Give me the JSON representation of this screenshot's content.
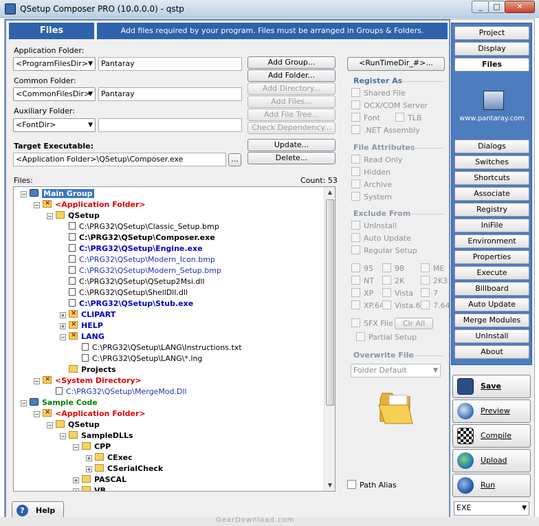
{
  "window": {
    "title": "QSetup Composer PRO (10.0.0.0) - qstp",
    "min": "_",
    "max": "□",
    "close": "✕"
  },
  "header": {
    "tab": "Files",
    "banner": "Add files required by your program.  Files must be arranged in Groups & Folders."
  },
  "folders": {
    "app_label": "Application Folder:",
    "app_combo": "<ProgramFilesDir>",
    "app_value": "Pantaray",
    "common_label": "Common Folder:",
    "common_combo": "<CommonFilesDir>",
    "common_value": "Pantaray",
    "aux_label": "Auxiliary Folder:",
    "aux_combo": "<FontDir>",
    "aux_value": ""
  },
  "buttons": {
    "add_group": "Add Group...",
    "add_folder": "Add Folder...",
    "add_directory": "Add Directory...",
    "add_files": "Add Files...",
    "add_file_tree": "Add File Tree...",
    "check_dependency": "Check Dependency...",
    "update": "Update...",
    "delete": "Delete...",
    "runtime_dir": "<RunTimeDir_#>...",
    "browse": "...",
    "clr_all": "Clr All",
    "help": "Help"
  },
  "target": {
    "label": "Target Executable:",
    "value": "<Application Folder>\\QSetup\\Composer.exe"
  },
  "files": {
    "label": "Files:",
    "count": "Count: 53"
  },
  "tree": [
    {
      "label": "Main Group",
      "style": "sel",
      "icon": "grpi",
      "indent": 0,
      "exp": "−"
    },
    {
      "label": "<Application Folder>",
      "style": "red",
      "icon": "foldx",
      "indent": 1,
      "exp": "−"
    },
    {
      "label": "QSetup",
      "style": "bold",
      "icon": "fold",
      "indent": 2,
      "exp": "−"
    },
    {
      "label": "C:\\PRG32\\QSetup\\Classic_Setup.bmp",
      "style": "",
      "icon": "doc",
      "indent": 3,
      "exp": ""
    },
    {
      "label": "C:\\PRG32\\QSetup\\Composer.exe",
      "style": "bold",
      "icon": "doc",
      "indent": 3,
      "exp": ""
    },
    {
      "label": "C:\\PRG32\\QSetup\\Engine.exe",
      "style": "blueb",
      "icon": "doc",
      "indent": 3,
      "exp": ""
    },
    {
      "label": "C:\\PRG32\\QSetup\\Modern_Icon.bmp",
      "style": "blue",
      "icon": "doc",
      "indent": 3,
      "exp": ""
    },
    {
      "label": "C:\\PRG32\\QSetup\\Modern_Setup.bmp",
      "style": "blue",
      "icon": "doc",
      "indent": 3,
      "exp": ""
    },
    {
      "label": "C:\\PRG32\\QSetup\\QSetup2Msi.dll",
      "style": "",
      "icon": "doc",
      "indent": 3,
      "exp": ""
    },
    {
      "label": "C:\\PRG32\\QSetup\\ShellDll.dll",
      "style": "",
      "icon": "doc",
      "indent": 3,
      "exp": ""
    },
    {
      "label": "C:\\PRG32\\QSetup\\Stub.exe",
      "style": "blueb",
      "icon": "doc",
      "indent": 3,
      "exp": ""
    },
    {
      "label": "CLIPART",
      "style": "blueb",
      "icon": "foldx",
      "indent": 3,
      "exp": "+"
    },
    {
      "label": "HELP",
      "style": "blueb",
      "icon": "foldx",
      "indent": 3,
      "exp": "+"
    },
    {
      "label": "LANG",
      "style": "blueb",
      "icon": "foldx",
      "indent": 3,
      "exp": "−"
    },
    {
      "label": "C:\\PRG32\\QSetup\\LANG\\Instructions.txt",
      "style": "",
      "icon": "doc",
      "indent": 4,
      "exp": ""
    },
    {
      "label": "C:\\PRG32\\QSetup\\LANG\\*.lng",
      "style": "",
      "icon": "doc",
      "indent": 4,
      "exp": ""
    },
    {
      "label": "Projects",
      "style": "bold",
      "icon": "fold",
      "indent": 3,
      "exp": ""
    },
    {
      "label": "<System Directory>",
      "style": "red",
      "icon": "foldx",
      "indent": 1,
      "exp": "−"
    },
    {
      "label": "C:\\PRG32\\QSetup\\MergeMod.Dll",
      "style": "blue",
      "icon": "doc",
      "indent": 2,
      "exp": ""
    },
    {
      "label": "Sample Code",
      "style": "green",
      "icon": "grpi",
      "indent": 0,
      "exp": "−"
    },
    {
      "label": "<Application Folder>",
      "style": "red",
      "icon": "foldx",
      "indent": 1,
      "exp": "−"
    },
    {
      "label": "QSetup",
      "style": "bold",
      "icon": "fold",
      "indent": 2,
      "exp": "−"
    },
    {
      "label": "SampleDLLs",
      "style": "bold",
      "icon": "fold",
      "indent": 3,
      "exp": "−"
    },
    {
      "label": "CPP",
      "style": "bold",
      "icon": "fold",
      "indent": 4,
      "exp": "−"
    },
    {
      "label": "CExec",
      "style": "bold",
      "icon": "fold",
      "indent": 5,
      "exp": "+"
    },
    {
      "label": "CSerialCheck",
      "style": "bold",
      "icon": "fold",
      "indent": 5,
      "exp": "+"
    },
    {
      "label": "PASCAL",
      "style": "bold",
      "icon": "fold",
      "indent": 4,
      "exp": "+"
    },
    {
      "label": "VB",
      "style": "bold",
      "icon": "fold",
      "indent": 4,
      "exp": "+"
    }
  ],
  "register": {
    "title": "Register As",
    "shared": "Shared File",
    "ocx": "OCX/COM Server",
    "font": "Font",
    "tlb": "TLB",
    "net": ".NET Assembly"
  },
  "attributes": {
    "title": "File Attributes",
    "read_only": "Read Only",
    "hidden": "Hidden",
    "archive": "Archive",
    "system": "System"
  },
  "exclude": {
    "title": "Exclude From",
    "uninstall": "UnInstall",
    "auto_update": "Auto Update",
    "regular_setup": "Regular Setup",
    "os": [
      "95",
      "98",
      "ME",
      "NT",
      "2K",
      "2K3",
      "XP",
      "Vista",
      "7",
      "XP.64",
      "Vista.64",
      "7.64"
    ],
    "sfx": "SFX File",
    "partial": "Partial Setup"
  },
  "overwrite": {
    "title": "Overwrite File",
    "value": "Folder Default"
  },
  "path_alias": "Path Alias",
  "nav": [
    "Project",
    "Display",
    "Files",
    "Dialogs",
    "Switches",
    "Shortcuts",
    "Associate",
    "Registry",
    "IniFile",
    "Environment",
    "Properties",
    "Execute",
    "Billboard",
    "Auto Update",
    "Merge Modules",
    "UnInstall",
    "About"
  ],
  "logo_url": "www.pantaray.com",
  "actions": {
    "save": "Save",
    "preview": "Preview",
    "compile": "Compile",
    "upload": "Upload",
    "run": "Run"
  },
  "output_type": "EXE",
  "watermark": "GearDownload.com"
}
